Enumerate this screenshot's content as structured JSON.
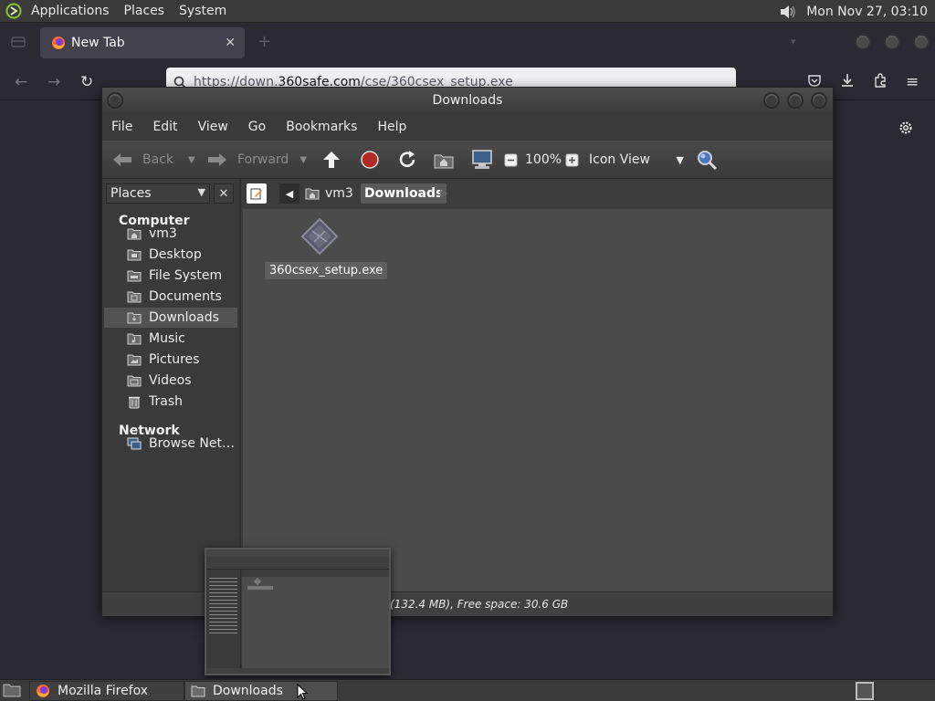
{
  "top_panel": {
    "menus": [
      "Applications",
      "Places",
      "System"
    ],
    "clock": "Mon Nov 27, 03:10",
    "volume_icon": "volume-icon",
    "logo_icon": "mate-logo-icon"
  },
  "firefox": {
    "tab_title": "New Tab",
    "url_prefix": "https://down.",
    "url_domain": "360safe.com",
    "url_path": "/cse/360csex_setup.exe",
    "colors": {
      "chrome": "#2b2a33",
      "tab": "#42414d",
      "urlbar": "#f0f0f4"
    }
  },
  "file_manager": {
    "title": "Downloads",
    "menus": [
      "File",
      "Edit",
      "View",
      "Go",
      "Bookmarks",
      "Help"
    ],
    "toolbar": {
      "back": "Back",
      "forward": "Forward",
      "zoom": "100%",
      "view_mode": "Icon View"
    },
    "sidebar": {
      "selector": "Places",
      "sections": [
        {
          "heading": "Computer",
          "items": [
            {
              "label": "vm3",
              "icon": "home-folder-icon"
            },
            {
              "label": "Desktop",
              "icon": "desktop-folder-icon"
            },
            {
              "label": "File System",
              "icon": "drive-icon"
            },
            {
              "label": "Documents",
              "icon": "folder-icon"
            },
            {
              "label": "Downloads",
              "icon": "folder-icon",
              "selected": true
            },
            {
              "label": "Music",
              "icon": "folder-icon"
            },
            {
              "label": "Pictures",
              "icon": "folder-icon"
            },
            {
              "label": "Videos",
              "icon": "folder-icon"
            },
            {
              "label": "Trash",
              "icon": "trash-icon"
            }
          ]
        },
        {
          "heading": "Network",
          "items": [
            {
              "label": "Browse Net…",
              "icon": "network-icon"
            }
          ]
        }
      ]
    },
    "path": [
      "vm3",
      "Downloads"
    ],
    "files": [
      {
        "name": "360csex_setup.exe",
        "icon": "executable-file-icon"
      }
    ],
    "status": "(132.4 MB), Free space: 30.6 GB"
  },
  "taskbar": {
    "tasks": [
      {
        "label": "Mozilla Firefox",
        "icon": "firefox-icon"
      },
      {
        "label": "Downloads",
        "icon": "folder-icon"
      }
    ]
  }
}
